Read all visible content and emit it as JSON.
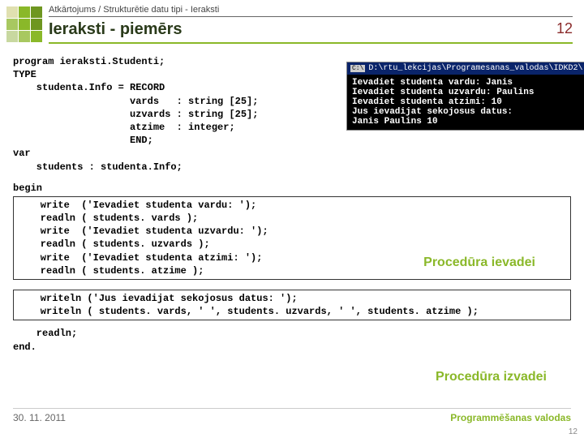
{
  "header": {
    "supertitle": "Atkārtojums / Strukturētie datu tipi - Ieraksti",
    "title": "Ieraksti - piemērs",
    "slide_number": "12"
  },
  "code": {
    "decl": "program ieraksti.Studenti;\nTYPE\n    studenta.Info = RECORD\n                    vards   : string [25];\n                    uzvards : string [25];\n                    atzime  : integer;\n                    END;\nvar\n    students : studenta.Info;",
    "begin": "begin",
    "block1": "    write  ('Ievadiet studenta vardu: ');\n    readln ( students. vards );\n    write  ('Ievadiet studenta uzvardu: ');\n    readln ( students. uzvards );\n    write  ('Ievadiet studenta atzimi: ');\n    readln ( students. atzime );",
    "block2": "    writeln ('Jus ievadijat sekojosus datus: ');\n    writeln ( students. vards, ' ', students. uzvards, ' ', students. atzime );",
    "tail": "    readln;\nend."
  },
  "console": {
    "title_prefix": "C:\\",
    "title_path": "D:\\rtu_lekcijas\\Programesanas_valodas\\IDKD2\\",
    "body": "Ievadiet studenta vardu: Janis\nIevadiet studenta uzvardu: Paulins\nIevadiet studenta atzimi: 10\nJus ievadijat sekojosus datus:\nJanis Paulins 10"
  },
  "annotations": {
    "input_proc": "Procedūra ievadei",
    "output_proc": "Procedūra izvadei"
  },
  "footer": {
    "date": "30. 11. 2011",
    "course": "Programmēšanas valodas",
    "page": "12"
  }
}
